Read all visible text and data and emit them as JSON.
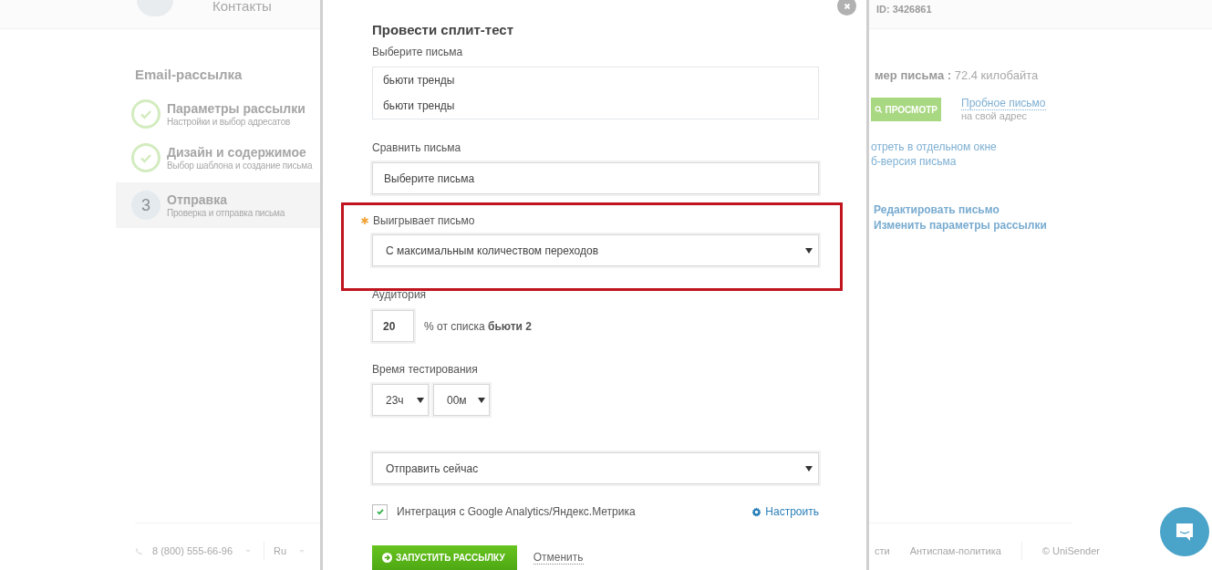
{
  "header": {
    "nav": [
      "Контакты"
    ],
    "account_id": "ID: 3426861"
  },
  "sidebar": {
    "title": "Email-рассылка",
    "steps": [
      {
        "kind": "done",
        "title": "Параметры рассылки",
        "subtitle": "Настройки и выбор адресатов",
        "selected": false
      },
      {
        "kind": "done",
        "title": "Дизайн и содержимое",
        "subtitle": "Выбор шаблона и создание письма",
        "selected": false
      },
      {
        "kind": "number",
        "marker": "3",
        "title": "Отправка",
        "subtitle": "Проверка и отправка письма",
        "selected": true
      }
    ]
  },
  "preview": {
    "size_label": "мер письма :",
    "size_value": "72.4 килобайта",
    "preview_button": "ПРОСМОТР",
    "test_link": "Пробное письмо",
    "test_hint": "на свой адрес",
    "links": [
      "отреть в отдельном окне",
      "б-версия письма"
    ],
    "actions": [
      "Редактировать письмо",
      "Изменить параметры рассылки"
    ]
  },
  "footer": {
    "phone": "8 (800) 555-66-96",
    "language": "Ru",
    "links": [
      "сти",
      "Антиспам-политика"
    ],
    "copyright": "© UniSender"
  },
  "modal": {
    "title": "Провести сплит-тест",
    "letters": {
      "label": "Выберите письма",
      "items": [
        "бьюти тренды",
        "бьюти тренды"
      ]
    },
    "compare": {
      "label": "Сравнить письма",
      "value": "Выберите письма"
    },
    "winner": {
      "label": "Выигрывает письмо",
      "required": true,
      "highlighted": true,
      "value": "С максимальным количеством переходов"
    },
    "audience": {
      "label": "Аудитория",
      "value": "20",
      "suffix": "% от списка **бьюти 2**"
    },
    "duration": {
      "label": "Время тестирования",
      "hours": "23ч",
      "minutes": "00м"
    },
    "schedule": {
      "value": "Отправить сейчас"
    },
    "analytics": {
      "label": "Интеграция с Google Analytics/Яндекс.Метрика",
      "checked": true,
      "settings_link": "Настроить"
    },
    "submit": "ЗАПУСТИТЬ РАССЫЛКУ",
    "cancel": "Отменить"
  }
}
